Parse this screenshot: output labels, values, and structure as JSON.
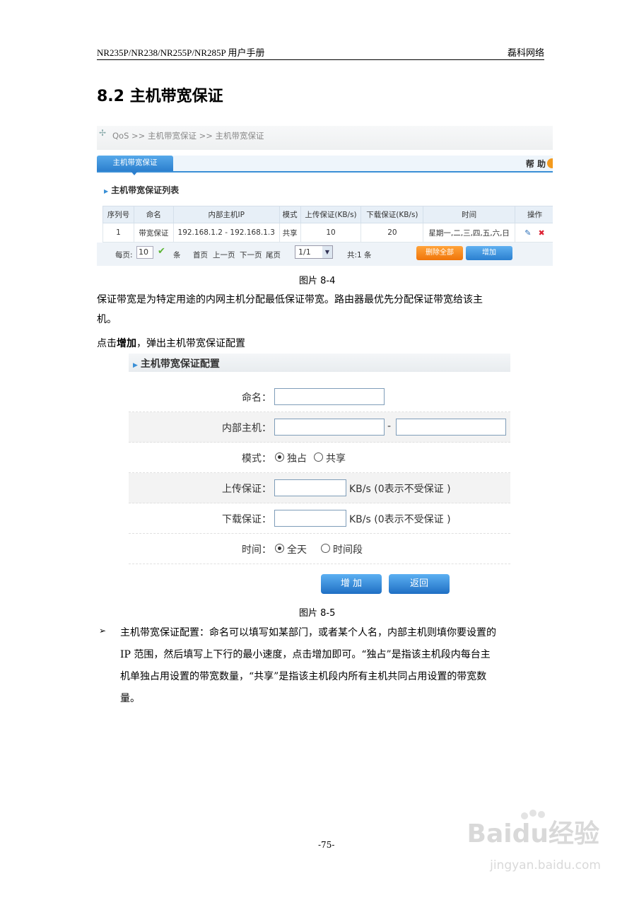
{
  "header": {
    "left": "NR235P/NR238/NR255P/NR285P 用户手册",
    "right": "磊科网络"
  },
  "section_title": "8.2 主机带宽保证",
  "fig1": {
    "breadcrumb": "QoS  >>  主机带宽保证  >>  主机带宽保证",
    "tab": "主机带宽保证",
    "help": "帮 助",
    "list_title": "主机带宽保证列表",
    "columns": [
      "序列号",
      "命名",
      "内部主机IP",
      "模式",
      "上传保证(KB/s)",
      "下载保证(KB/s)",
      "时间",
      "操作"
    ],
    "rows": [
      [
        "1",
        "带宽保证",
        "192.168.1.2 - 192.168.1.3",
        "共享",
        "10",
        "20",
        "星期一,二,三,四,五,六,日"
      ]
    ],
    "pager": {
      "per_page_label": "每页:",
      "per_page_value": "10",
      "unit": "条",
      "first": "首页",
      "prev": "上一页",
      "next": "下一页",
      "last": "尾页",
      "page_value": "1/1",
      "total": "共:1 条",
      "delete_all": "删除全部",
      "add": "增加"
    }
  },
  "caption1": "图片  8-4",
  "para1_line1": "保证带宽是为特定用途的内网主机分配最低保证带宽。路由器最优先分配保证带宽给该主",
  "para1_line2": "机。",
  "para2_prefix": "点击",
  "para2_bold": "增加",
  "para2_suffix": "，弹出主机带宽保证配置",
  "fig2": {
    "title": "主机带宽保证配置",
    "name_label": "命名：",
    "host_label": "内部主机：",
    "host_sep": "-",
    "mode_label": "模式：",
    "mode_exclusive": "独占",
    "mode_shared": "共享",
    "upload_label": "上传保证：",
    "upload_hint": "KB/s (0表示不受保证 )",
    "download_label": "下载保证：",
    "download_hint": "KB/s (0表示不受保证 )",
    "time_label": "时间：",
    "time_allday": "全天",
    "time_period": "时间段",
    "add_button": "增 加",
    "back_button": "返回"
  },
  "caption2": "图片  8-5",
  "bullet": {
    "mark": "➢",
    "lines": [
      "主机带宽保证配置：命名可以填写如某部门，或者某个人名，内部主机则填你要设置的",
      "IP 范围，然后填写上下行的最小速度，点击增加即可。“独占”是指该主机段内每台主",
      "机单独占用设置的带宽数量，“共享”是指该主机段内所有主机共同占用设置的带宽数",
      "量。"
    ]
  },
  "page_number": "-75-",
  "watermark": {
    "logo": "Baidu经验",
    "url": "jingyan.baidu.com"
  }
}
